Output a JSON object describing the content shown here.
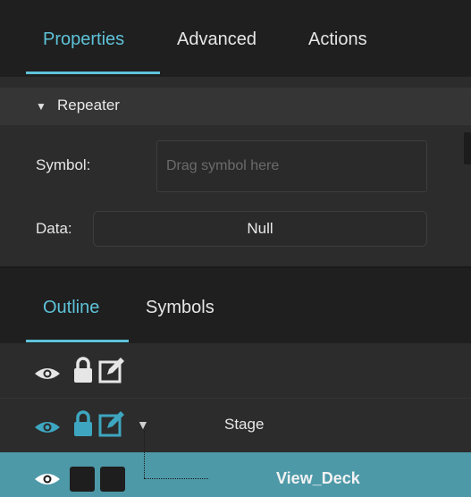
{
  "top_tabs": [
    {
      "label": "Properties",
      "active": true
    },
    {
      "label": "Advanced",
      "active": false
    },
    {
      "label": "Actions",
      "active": false
    }
  ],
  "repeater": {
    "title": "Repeater",
    "symbol_label": "Symbol:",
    "symbol_placeholder": "Drag symbol here",
    "data_label": "Data:",
    "data_value": "Null"
  },
  "bottom_tabs": [
    {
      "label": "Outline",
      "active": true
    },
    {
      "label": "Symbols",
      "active": false
    }
  ],
  "outline": {
    "header_icons": [
      "eye-icon",
      "lock-icon",
      "edit-icon"
    ],
    "rows": [
      {
        "label": "Stage",
        "expanded": true,
        "icons": [
          "eye-icon",
          "lock-icon",
          "edit-icon"
        ],
        "icon_color": "#3ea6c0"
      },
      {
        "label": "View_Deck",
        "selected": true,
        "icons": [
          "eye-icon",
          "square",
          "square"
        ]
      }
    ]
  },
  "colors": {
    "accent": "#5ec2d8",
    "selected_row": "#4d99a8",
    "panel_bg": "#2c2c2c",
    "tabbar_bg": "#1f1f1f"
  }
}
